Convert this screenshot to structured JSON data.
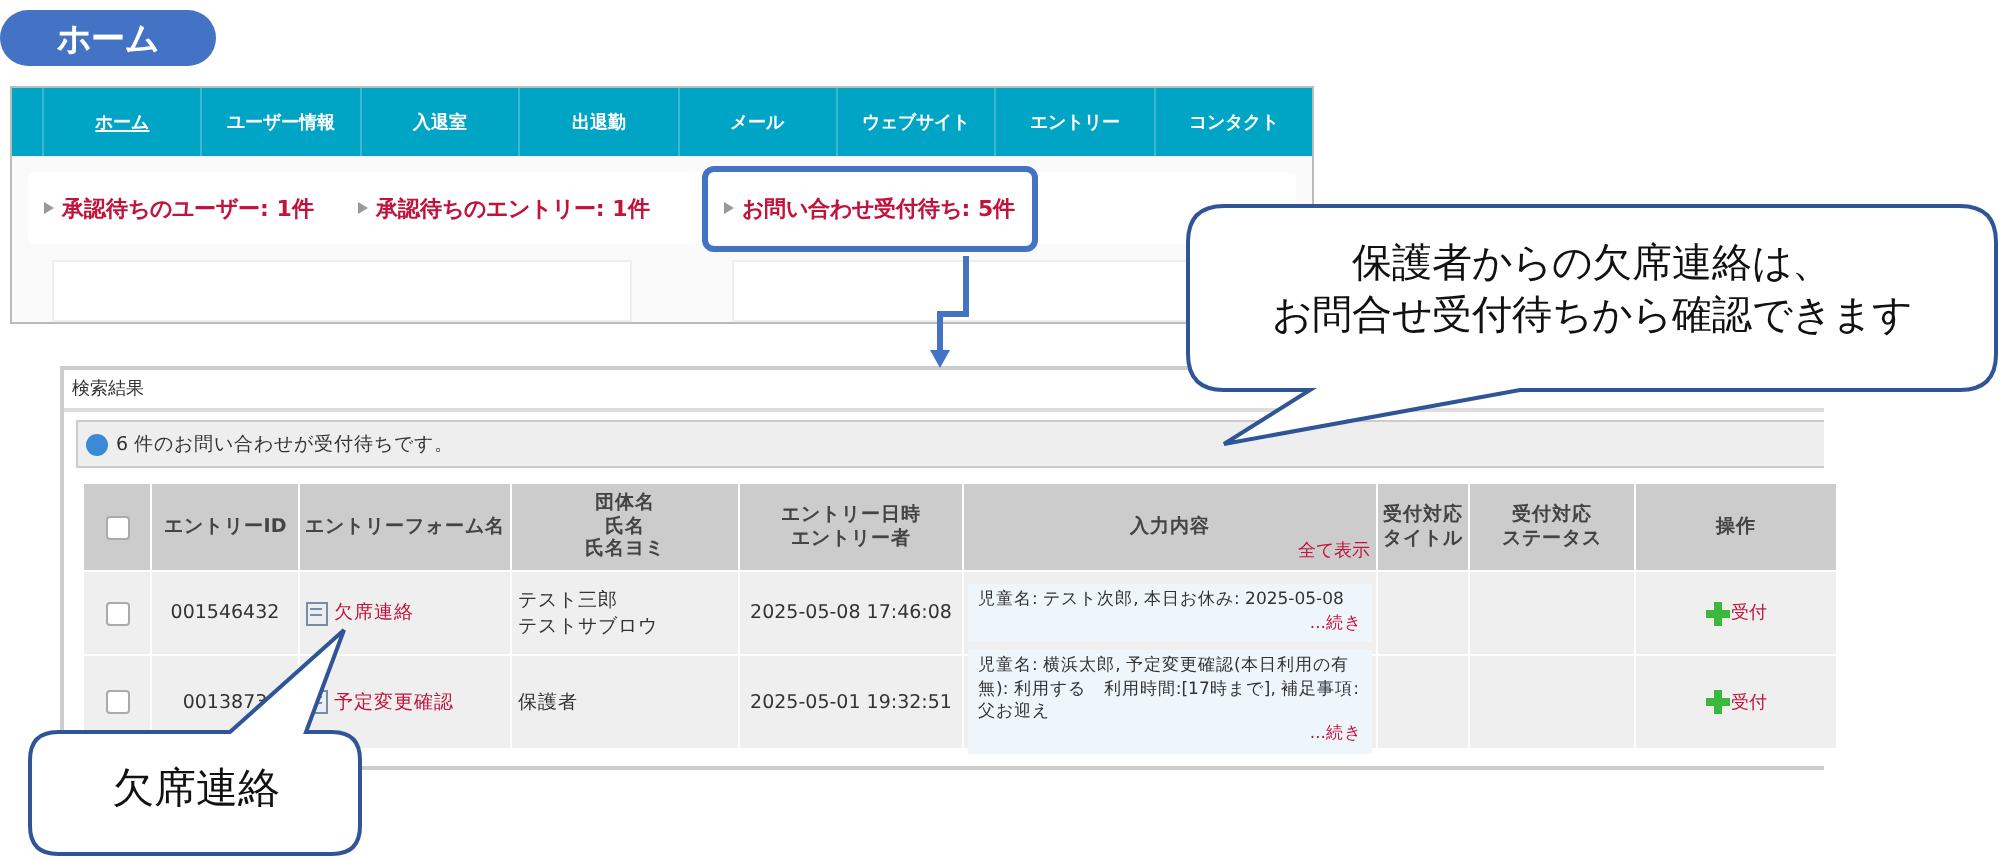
{
  "home_badge": "ホーム",
  "nav": {
    "items": [
      {
        "label": "ホーム",
        "selected": true
      },
      {
        "label": "ユーザー情報",
        "selected": false
      },
      {
        "label": "入退室",
        "selected": false
      },
      {
        "label": "出退勤",
        "selected": false
      },
      {
        "label": "メール",
        "selected": false
      },
      {
        "label": "ウェブサイト",
        "selected": false
      },
      {
        "label": "エントリー",
        "selected": false
      },
      {
        "label": "コンタクト",
        "selected": false
      }
    ]
  },
  "pending": [
    {
      "label": "承認待ちのユーザー: 1件",
      "highlighted": false
    },
    {
      "label": "承認待ちのエントリー: 1件",
      "highlighted": false
    },
    {
      "label": "お問い合わせ受付待ち: 5件",
      "highlighted": true
    }
  ],
  "results": {
    "title": "検索結果",
    "info": "6 件のお問い合わせが受付待ちです。",
    "select_all_checked": false,
    "columns": [
      {
        "lines": [
          "エントリーID"
        ]
      },
      {
        "lines": [
          "エントリーフォーム名"
        ]
      },
      {
        "lines": [
          "団体名",
          "氏名",
          "氏名ヨミ"
        ]
      },
      {
        "lines": [
          "エントリー日時",
          "エントリー者"
        ]
      },
      {
        "lines": [
          "入力内容"
        ]
      },
      {
        "lines": [
          "受付対応",
          "タイトル"
        ]
      },
      {
        "lines": [
          "受付対応",
          "ステータス"
        ]
      },
      {
        "lines": [
          "操作"
        ]
      }
    ],
    "show_all": "全て表示",
    "rows": [
      {
        "checked": false,
        "entry_id": "001546432",
        "form_name": "欠席連絡",
        "name_lines": [
          "テスト三郎",
          "テストサブロウ"
        ],
        "datetime": "2025-05-08 17:46:08",
        "content": "児童名: テスト次郎, 本日お休み: 2025-05-08",
        "more": "...続き",
        "action": "受付"
      },
      {
        "checked": false,
        "entry_id": "0013873",
        "form_name": "予定変更確認",
        "name_lines": [
          "保護者"
        ],
        "datetime": "2025-05-01 19:32:51",
        "content": "児童名: 横浜太郎, 予定変更確認(本日利用の有無): 利用する　利用時間:[17時まで], 補足事項: 父お迎え",
        "more": "...続き",
        "action": "受付"
      }
    ]
  },
  "callouts": [
    {
      "lines": [
        "保護者からの欠席連絡は、",
        "お問合せ受付待ちから確認できます"
      ]
    },
    {
      "lines": [
        "欠席連絡"
      ]
    }
  ]
}
